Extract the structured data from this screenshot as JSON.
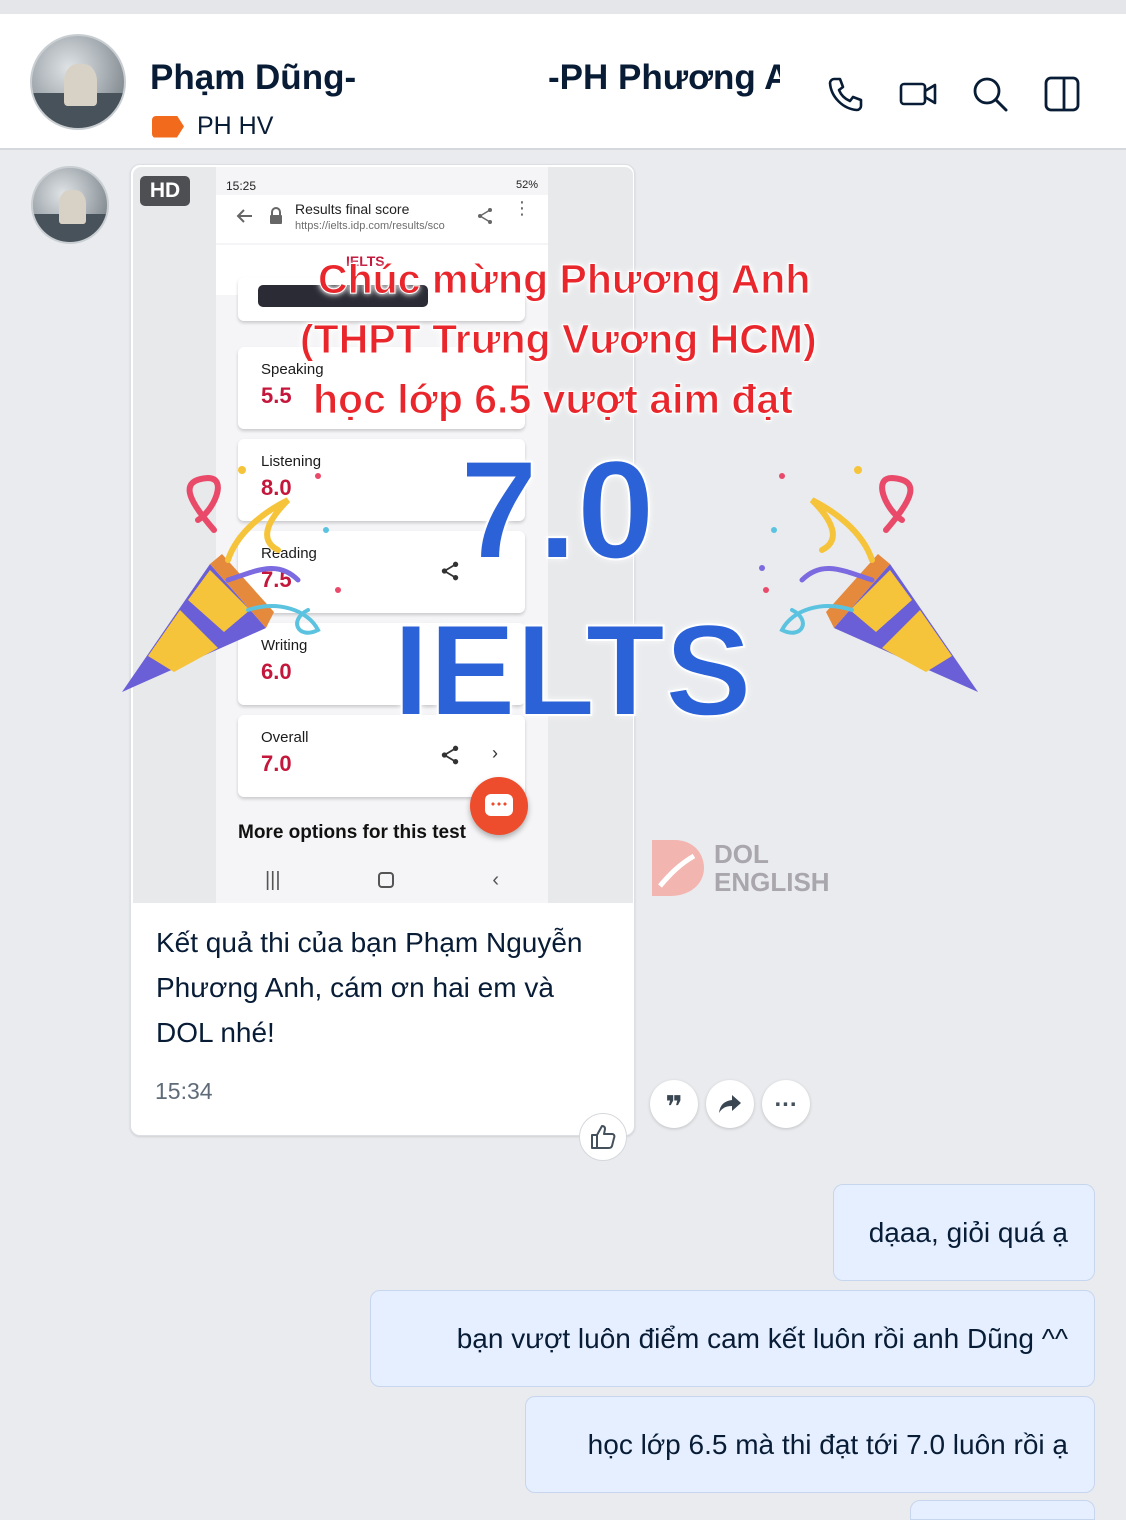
{
  "header": {
    "contact_name_left": "Phạm Dũng-",
    "contact_name_right": "-PH Phương A",
    "tag_label": "PH HV",
    "icons": [
      "phone-icon",
      "video-call-icon",
      "search-icon",
      "sidebar-toggle-icon"
    ]
  },
  "message": {
    "hd_badge": "HD",
    "screenshot": {
      "status_time": "15:25",
      "status_battery": "52%",
      "url_title": "Results final score",
      "url_address": "https://ielts.idp.com/results/sco",
      "logo_text": "IELTS",
      "scores": [
        {
          "label": "Speaking",
          "value": "5.5"
        },
        {
          "label": "Listening",
          "value": "8.0"
        },
        {
          "label": "Reading",
          "value": "7.5"
        },
        {
          "label": "Writing",
          "value": "6.0"
        },
        {
          "label": "Overall",
          "value": "7.0"
        }
      ],
      "more_options": "More options for this test"
    },
    "overlay": {
      "line1": "Chúc mừng Phương Anh",
      "line2": "(THPT Trưng Vương HCM)",
      "line3": "học lớp 6.5 vượt aim đạt",
      "score": "7.0",
      "exam": "IELTS"
    },
    "watermark_line1": "DOL",
    "watermark_line2": "ENGLISH",
    "caption": "Kết quả thi của bạn Phạm Nguyễn Phương Anh, cám ơn hai em và DOL nhé!",
    "time": "15:34"
  },
  "actions": [
    "quote-icon",
    "forward-icon",
    "more-icon",
    "like-icon"
  ],
  "replies": [
    "dạaa, giỏi quá ạ",
    "bạn vượt luôn điểm cam kết luôn rồi anh Dũng ^^",
    "học lớp 6.5 mà thi đạt tới 7.0 luôn rồi ạ"
  ],
  "colors": {
    "accent_blue": "#2c62d8",
    "overlay_red": "#e8262b",
    "tag_orange": "#f26b1d",
    "score_red": "#c4173b",
    "bubble_bg": "#e5efff"
  }
}
